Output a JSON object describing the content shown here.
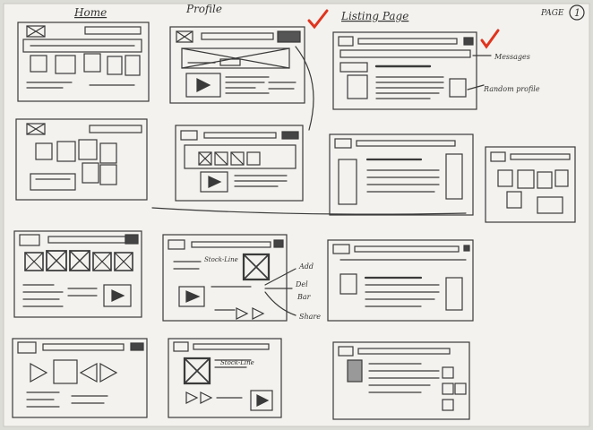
{
  "headings": {
    "home": "Home",
    "profile": "Profile",
    "listing": "Listing Page",
    "page": "PAGE",
    "page_number": "1"
  },
  "annotations": {
    "messages": "Messages",
    "profile_pic": "Random profile",
    "del": "Del",
    "bar": "Bar",
    "share": "Share",
    "add": "Add",
    "block_label": "Stock-Line",
    "block_label_2": "Stock-Line"
  },
  "colors": {
    "paper": "#f3f2ee",
    "ink": "#3a3a3a",
    "check": "#e0341e"
  }
}
